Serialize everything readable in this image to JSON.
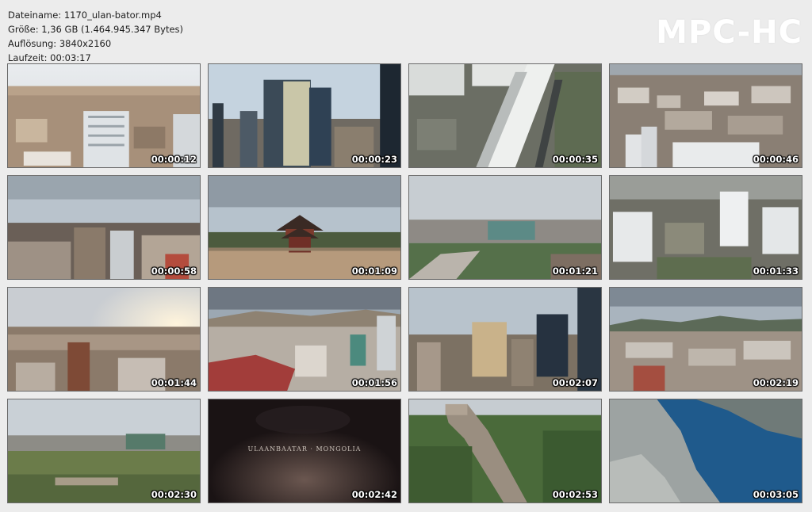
{
  "info": {
    "filename_line": "Dateiname: 1170_ulan-bator.mp4",
    "size_line": "Größe: 1,36 GB (1.464.945.347 Bytes)",
    "resolution_line": "Auflösung: 3840x2160",
    "duration_line": "Laufzeit: 00:03:17"
  },
  "logo": "MPC-HC",
  "title_card_text": "ULAANBAATAR · MONGOLIA",
  "thumbnails": [
    {
      "time": "00:00:12",
      "scene": "city-aerial"
    },
    {
      "time": "00:00:23",
      "scene": "glass-towers"
    },
    {
      "time": "00:00:35",
      "scene": "building-topdown"
    },
    {
      "time": "00:00:46",
      "scene": "dense-city"
    },
    {
      "time": "00:00:58",
      "scene": "city-skyline-cloudy"
    },
    {
      "time": "00:01:09",
      "scene": "pagoda"
    },
    {
      "time": "00:01:21",
      "scene": "suburb-road"
    },
    {
      "time": "00:01:33",
      "scene": "towers-aerial"
    },
    {
      "time": "00:01:44",
      "scene": "sunset-city"
    },
    {
      "time": "00:01:56",
      "scene": "red-roofs"
    },
    {
      "time": "00:02:07",
      "scene": "downtown-towers"
    },
    {
      "time": "00:02:19",
      "scene": "city-mountains"
    },
    {
      "time": "00:02:30",
      "scene": "green-field"
    },
    {
      "time": "00:02:42",
      "scene": "title-card"
    },
    {
      "time": "00:02:53",
      "scene": "great-wall"
    },
    {
      "time": "00:03:05",
      "scene": "fjord"
    }
  ]
}
